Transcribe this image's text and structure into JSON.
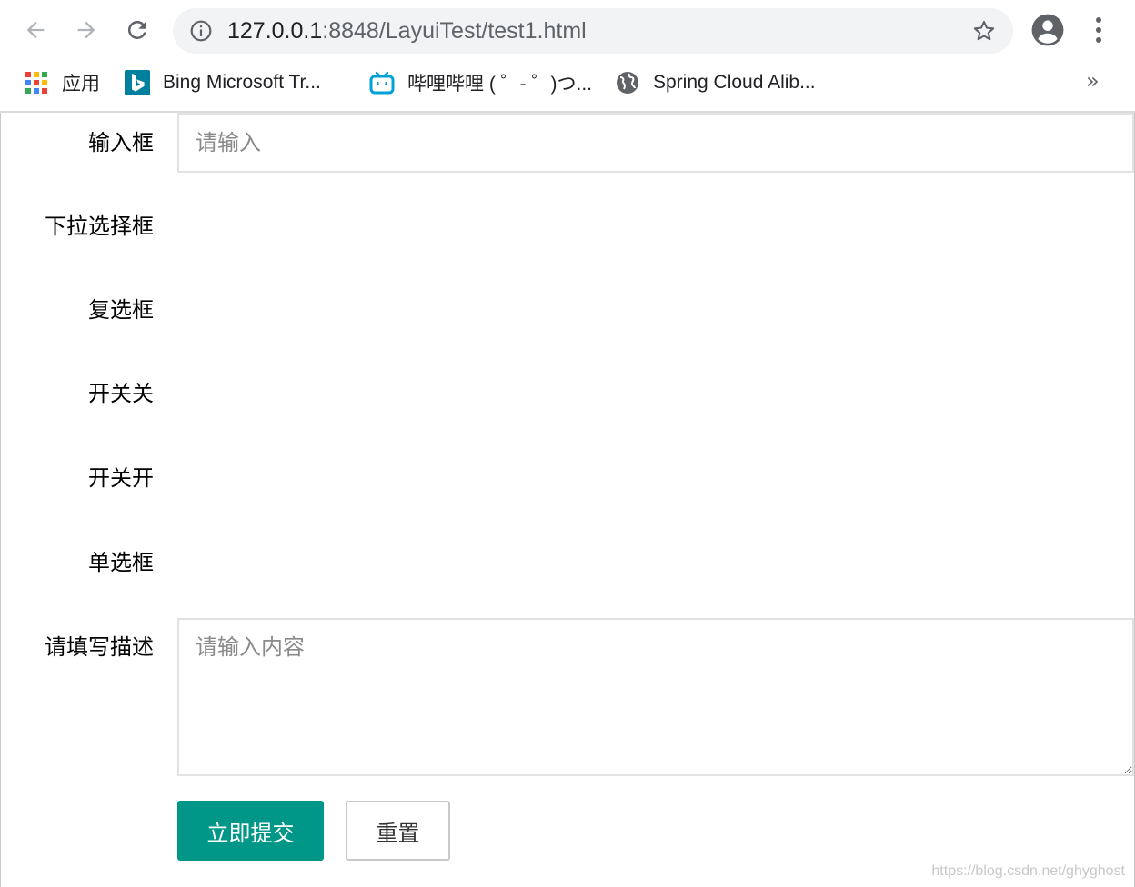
{
  "browser": {
    "url_host": "127.0.0.1",
    "url_rest": ":8848/LayuiTest/test1.html",
    "bookmarks": [
      {
        "label": "应用",
        "icon": "apps-grid-icon"
      },
      {
        "label": "Bing Microsoft Tr...",
        "icon": "bing-icon"
      },
      {
        "label": "哔哩哔哩 ( ゜- ゜)つ...",
        "icon": "bilibili-icon"
      },
      {
        "label": "Spring Cloud Alib...",
        "icon": "globe-icon"
      }
    ],
    "more_label": "»",
    "colors": {
      "bing": "#00809d",
      "bilibili": "#00a1d6"
    }
  },
  "form": {
    "input_label": "输入框",
    "input_placeholder": "请输入",
    "select_label": "下拉选择框",
    "checkbox_label": "复选框",
    "switch_off_label": "开关关",
    "switch_on_label": "开关开",
    "radio_label": "单选框",
    "desc_label": "请填写描述",
    "desc_placeholder": "请输入内容",
    "submit_label": "立即提交",
    "reset_label": "重置",
    "colors": {
      "primary": "#009688"
    }
  },
  "watermark": "https://blog.csdn.net/ghyghost"
}
